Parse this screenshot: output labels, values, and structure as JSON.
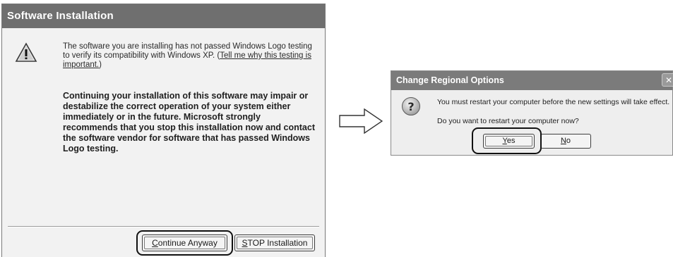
{
  "install_dialog": {
    "title": "Software Installation",
    "icon": "warning-icon",
    "message_part1": "The software you are installing has not passed Windows Logo testing to verify its compatibility with Windows XP. (",
    "link_text": "Tell me why this testing is important.",
    "message_part1_end": ")",
    "warning_text": "Continuing your installation of this software may impair or destabilize the correct operation of your system either immediately or in the future. Microsoft strongly recommends that you stop this installation now and contact the software vendor for software that has passed Windows Logo testing.",
    "continue_button": {
      "accel": "C",
      "rest": "ontinue Anyway"
    },
    "stop_button": {
      "accel": "S",
      "rest": "TOP Installation"
    }
  },
  "arrow_icon": "right-arrow-outline-icon",
  "regional_dialog": {
    "title": "Change Regional Options",
    "close_label": "✕",
    "icon": "question-icon",
    "message_line1": "You must restart your computer before the new settings will take effect.",
    "message_line2": "Do you want to restart your computer now?",
    "yes_button": {
      "accel": "Y",
      "rest": "es"
    },
    "no_button": {
      "accel": "N",
      "rest": "o"
    }
  }
}
